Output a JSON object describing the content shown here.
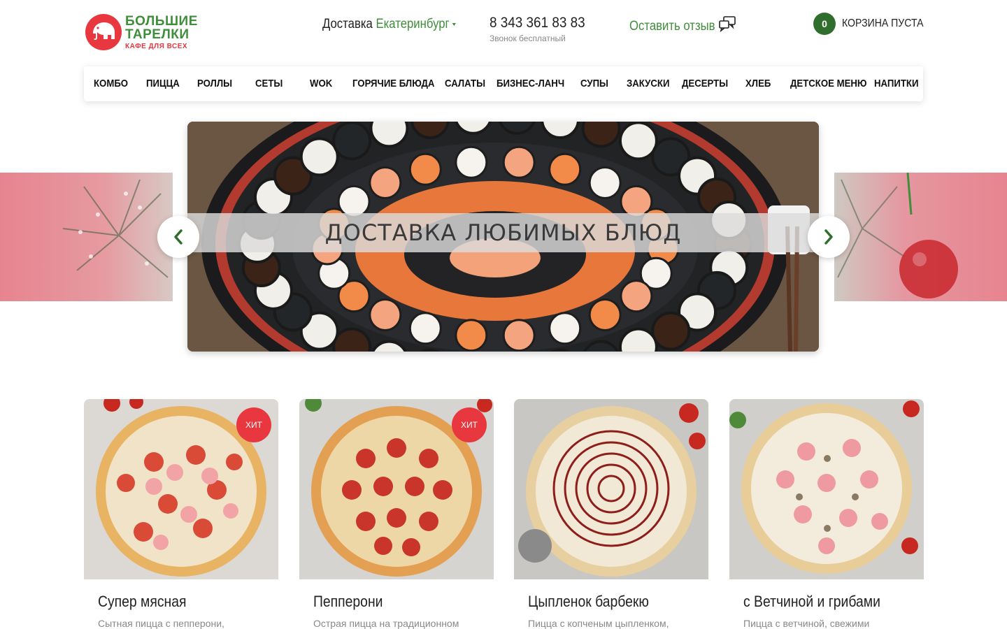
{
  "header": {
    "logo": {
      "line1": "БОЛЬШИЕ",
      "line2": "ТАРЕЛКИ",
      "line3": "КАФЕ ДЛЯ ВСЕХ",
      "icon": "elephant-icon"
    },
    "delivery": {
      "label": "Доставка",
      "city": "Екатеринбург"
    },
    "phone": {
      "number": "8 343 361 83 83",
      "note": "Звонок бесплатный"
    },
    "review": {
      "label": "Оставить отзыв",
      "icon": "chat-bubbles-icon"
    },
    "cart": {
      "count": "0",
      "label": "КОРЗИНА ПУСТА"
    }
  },
  "nav": {
    "items": [
      "КОМБО",
      "ПИЦЦА",
      "РОЛЛЫ",
      "СЕТЫ",
      "WOK",
      "ГОРЯЧИЕ БЛЮДА",
      "САЛАТЫ",
      "БИЗНЕС-ЛАНЧ",
      "СУПЫ",
      "ЗАКУСКИ",
      "ДЕСЕРТЫ",
      "ХЛЕБ",
      "ДЕТСКОЕ МЕНЮ",
      "НАПИТКИ"
    ]
  },
  "slider": {
    "banner_text": "ДОСТАВКА ЛЮБИМЫХ БЛЮД",
    "prev_icon": "chevron-left-icon",
    "next_icon": "chevron-right-icon"
  },
  "products": [
    {
      "name": "Супер мясная",
      "desc": "Сытная пицца с пепперони,",
      "badge": "ХИТ"
    },
    {
      "name": "Пепперони",
      "desc": "Острая пицца на традиционном",
      "badge": "ХИТ"
    },
    {
      "name": "Цыпленок барбекю",
      "desc": "Пицца с копченым цыпленком,",
      "badge": ""
    },
    {
      "name": "с Ветчиной и грибами",
      "desc": "Пицца с ветчиной, свежими",
      "badge": ""
    }
  ],
  "colors": {
    "brand_green": "#3f8e3b",
    "brand_red": "#e8373f",
    "cart_green": "#2f6e2c"
  }
}
